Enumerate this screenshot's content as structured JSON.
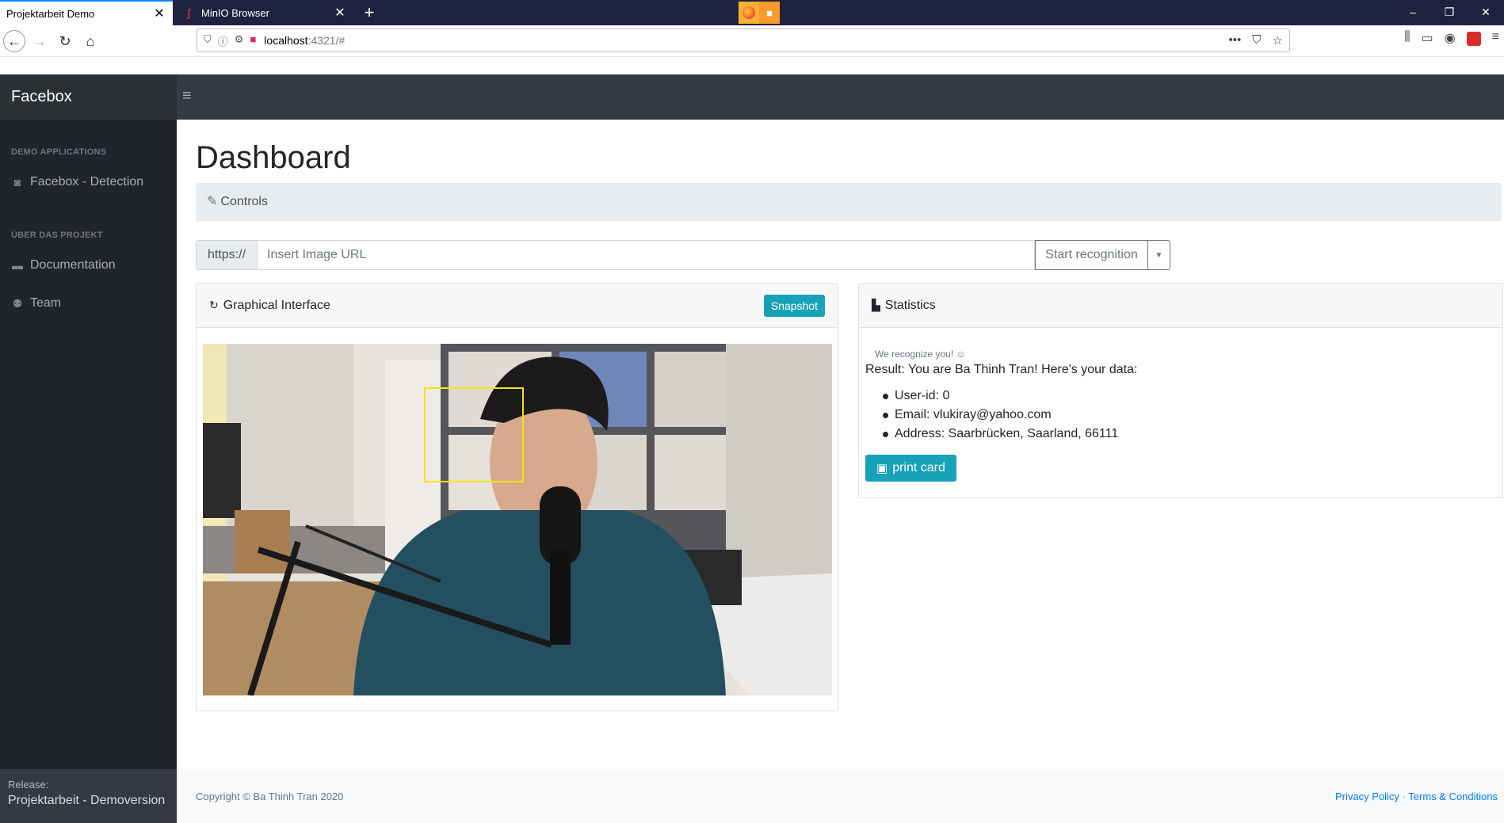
{
  "browser": {
    "tabs": [
      {
        "label": "Projektarbeit Demo",
        "active": true
      },
      {
        "label": "MinIO Browser",
        "active": false
      }
    ],
    "new_tab_icon": "+",
    "url_host": "localhost",
    "url_rest": ":4321/#",
    "window_controls": [
      "–",
      "❐",
      "✕"
    ]
  },
  "app": {
    "brand": "Facebox",
    "sidebar": {
      "sections": [
        {
          "heading": "DEMO APPLICATIONS",
          "items": [
            {
              "label": "Facebox - Detection",
              "icon": "camera-icon"
            }
          ]
        },
        {
          "heading": "ÜBER DAS PROJEKT",
          "items": [
            {
              "label": "Documentation",
              "icon": "comment-icon"
            },
            {
              "label": "Team",
              "icon": "users-icon"
            }
          ]
        }
      ],
      "release_label": "Release:",
      "release_value": "Projektarbeit - Demoversion"
    },
    "page_title": "Dashboard",
    "controls_label": "Controls",
    "url_prefix": "https://",
    "url_placeholder": "Insert Image URL",
    "start_button": "Start recognition",
    "graphical_interface": {
      "title": "Graphical Interface",
      "snapshot_button": "Snapshot"
    },
    "statistics": {
      "title": "Statistics",
      "recognize_text": "We recognize you! ☺",
      "result_text": "Result: You are Ba Thinh Tran! Here's your data:",
      "items": [
        "User-id: 0",
        "Email: vlukiray@yahoo.com",
        "Address: Saarbrücken, Saarland, 66111"
      ],
      "print_button": "print card"
    },
    "footer": {
      "copyright": "Copyright © Ba Thinh Tran 2020",
      "privacy": "Privacy Policy",
      "separator": "·",
      "terms": "Terms & Conditions"
    }
  },
  "colors": {
    "accent": "#17a2b8",
    "sidebar_bg": "#212529",
    "topbar_bg": "#343a40",
    "face_box": "#f2e600"
  }
}
